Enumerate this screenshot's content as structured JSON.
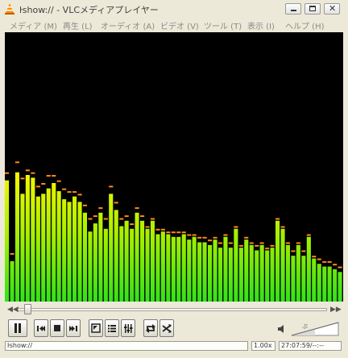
{
  "window": {
    "title": "ŀshow:// - VLCメディアプレイヤー"
  },
  "menu": {
    "items": [
      "メディア (M)",
      "再生 (L)",
      "オーディオ (A)",
      "ビデオ (V)",
      "ツール (T)",
      "表示 (I)",
      "ヘルプ (H)"
    ]
  },
  "visualizer": {
    "bar_colors": {
      "bottom": "#33e11b",
      "mid": "#a8f000",
      "top": "#fff600"
    },
    "peak_color": "#ff8a1a",
    "levels": [
      0.45,
      0.15,
      0.48,
      0.4,
      0.47,
      0.46,
      0.39,
      0.4,
      0.42,
      0.44,
      0.41,
      0.38,
      0.37,
      0.39,
      0.37,
      0.33,
      0.26,
      0.29,
      0.33,
      0.27,
      0.4,
      0.34,
      0.28,
      0.3,
      0.27,
      0.33,
      0.3,
      0.27,
      0.3,
      0.25,
      0.26,
      0.25,
      0.24,
      0.24,
      0.25,
      0.23,
      0.24,
      0.22,
      0.22,
      0.21,
      0.23,
      0.2,
      0.24,
      0.2,
      0.27,
      0.2,
      0.23,
      0.21,
      0.19,
      0.21,
      0.19,
      0.2,
      0.3,
      0.27,
      0.21,
      0.17,
      0.21,
      0.17,
      0.24,
      0.16,
      0.14,
      0.13,
      0.13,
      0.12,
      0.11
    ],
    "peaks": [
      0.48,
      0.18,
      0.52,
      0.46,
      0.49,
      0.48,
      0.43,
      0.44,
      0.47,
      0.47,
      0.45,
      0.42,
      0.41,
      0.41,
      0.4,
      0.36,
      0.31,
      0.32,
      0.35,
      0.31,
      0.43,
      0.37,
      0.31,
      0.32,
      0.29,
      0.35,
      0.32,
      0.28,
      0.31,
      0.27,
      0.27,
      0.26,
      0.26,
      0.26,
      0.26,
      0.25,
      0.25,
      0.24,
      0.24,
      0.23,
      0.24,
      0.22,
      0.25,
      0.22,
      0.28,
      0.21,
      0.24,
      0.22,
      0.21,
      0.22,
      0.2,
      0.21,
      0.31,
      0.28,
      0.22,
      0.19,
      0.22,
      0.19,
      0.25,
      0.17,
      0.16,
      0.15,
      0.15,
      0.14,
      0.13
    ]
  },
  "seek": {
    "position": 0.02
  },
  "controls": {
    "pause": "pause-icon",
    "prev": "skip-back-icon",
    "stop": "stop-icon",
    "next": "skip-forward-icon",
    "fullscreen": "fullscreen-icon",
    "playlist": "playlist-icon",
    "extended": "equalizer-icon",
    "loop": "loop-icon",
    "random": "shuffle-icon"
  },
  "volume": {
    "level": 0.5,
    "label": "ぷ"
  },
  "status": {
    "mrl": "ŀshow://",
    "speed": "1.00x",
    "time": "27:07:59/--:--"
  }
}
